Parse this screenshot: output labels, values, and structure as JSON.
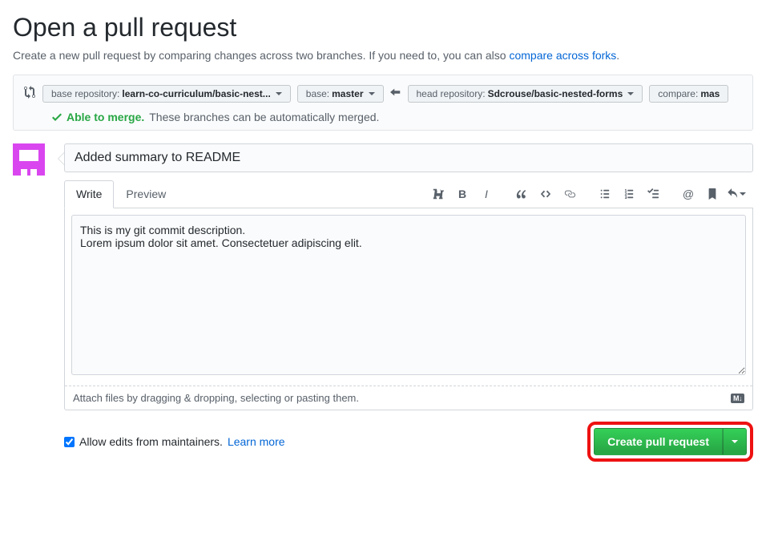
{
  "header": {
    "title": "Open a pull request",
    "subtitle_prefix": "Create a new pull request by comparing changes across two branches. If you need to, you can also ",
    "subtitle_link": "compare across forks",
    "subtitle_suffix": "."
  },
  "compare": {
    "base_repo_label": "base repository:",
    "base_repo_value": "learn-co-curriculum/basic-nest...",
    "base_branch_label": "base:",
    "base_branch_value": "master",
    "head_repo_label": "head repository:",
    "head_repo_value": "Sdcrouse/basic-nested-forms",
    "compare_branch_label": "compare:",
    "compare_branch_value": "mas",
    "merge_status_bold": "Able to merge.",
    "merge_status_text": "These branches can be automatically merged."
  },
  "form": {
    "title_value": "Added summary to README",
    "tabs": {
      "write": "Write",
      "preview": "Preview"
    },
    "description_value": "This is my git commit description.\nLorem ipsum dolor sit amet. Consectetuer adipiscing elit.",
    "attach_hint": "Attach files by dragging & dropping, selecting or pasting them.",
    "markdown_badge": "M↓"
  },
  "actions": {
    "allow_edits_label": "Allow edits from maintainers.",
    "learn_more": "Learn more",
    "create_button": "Create pull request"
  }
}
